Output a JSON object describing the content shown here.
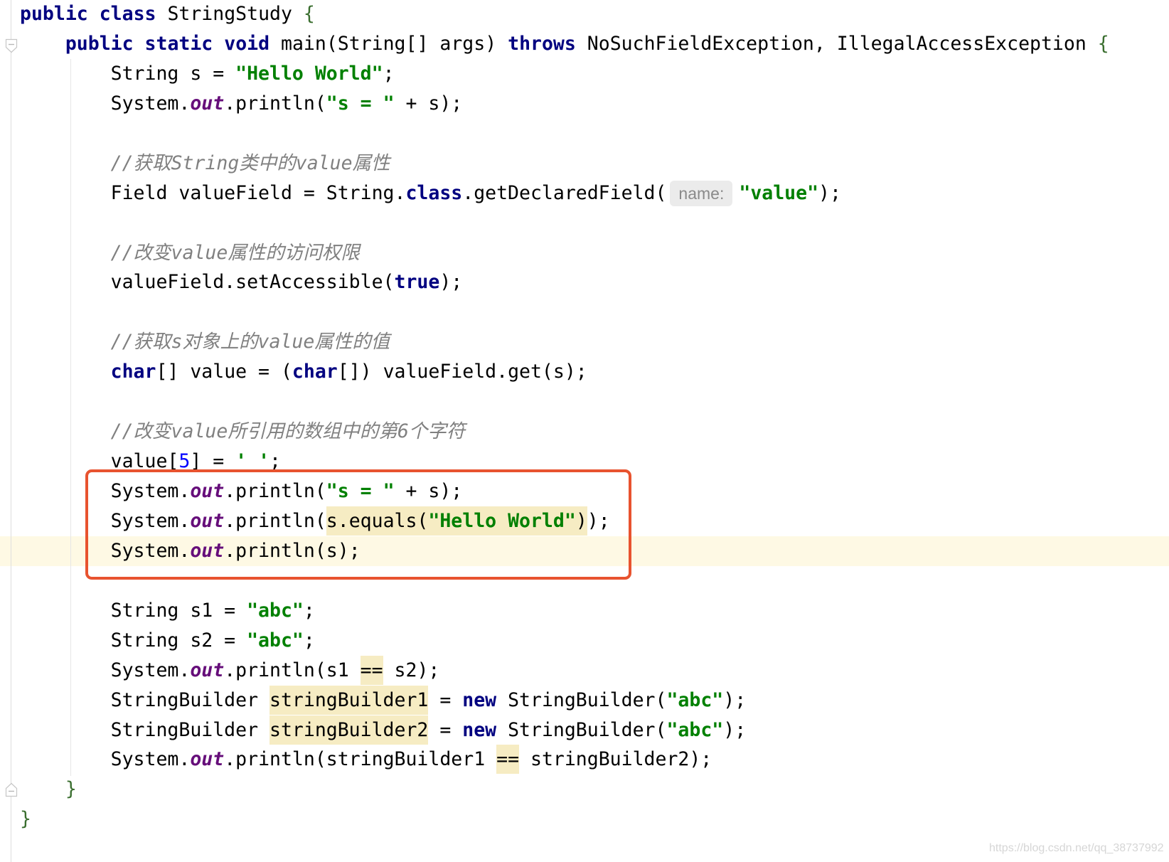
{
  "editor": {
    "theme": {
      "keyword": "#000080",
      "string": "#008000",
      "comment": "#808080",
      "static_field": "#660E7A",
      "number": "#0000FF",
      "text": "#000000",
      "brace": "#3A6E2F",
      "usage_highlight": "#F6ECC3",
      "current_line": "#FEF9E4",
      "hint_background": "#EBEBEB",
      "hint_text": "#8A8A8A"
    },
    "lines": [
      {
        "tokens": [
          {
            "k": "keyword",
            "t": "public"
          },
          {
            "k": "text",
            "t": " "
          },
          {
            "k": "keyword",
            "t": "class"
          },
          {
            "k": "text",
            "t": " StringStudy "
          },
          {
            "k": "brace",
            "t": "{"
          }
        ]
      },
      {
        "tokens": [
          {
            "k": "text",
            "t": "    "
          },
          {
            "k": "keyword",
            "t": "public"
          },
          {
            "k": "text",
            "t": " "
          },
          {
            "k": "keyword",
            "t": "static"
          },
          {
            "k": "text",
            "t": " "
          },
          {
            "k": "keyword",
            "t": "void"
          },
          {
            "k": "text",
            "t": " main(String[] args) "
          },
          {
            "k": "keyword",
            "t": "throws"
          },
          {
            "k": "text",
            "t": " NoSuchFieldException, IllegalAccessException "
          },
          {
            "k": "brace",
            "t": "{"
          }
        ]
      },
      {
        "tokens": [
          {
            "k": "text",
            "t": "        String s = "
          },
          {
            "k": "string",
            "t": "\"Hello World\""
          },
          {
            "k": "text",
            "t": ";"
          }
        ]
      },
      {
        "tokens": [
          {
            "k": "text",
            "t": "        System."
          },
          {
            "k": "field",
            "t": "out"
          },
          {
            "k": "text",
            "t": ".println("
          },
          {
            "k": "string",
            "t": "\"s = \""
          },
          {
            "k": "text",
            "t": " + s);"
          }
        ]
      },
      {
        "tokens": []
      },
      {
        "tokens": [
          {
            "k": "text",
            "t": "        "
          },
          {
            "k": "comment",
            "t": "//获取String类中的value属性"
          }
        ]
      },
      {
        "tokens": [
          {
            "k": "text",
            "t": "        Field valueField = String."
          },
          {
            "k": "keyword",
            "t": "class"
          },
          {
            "k": "text",
            "t": ".getDeclaredField("
          },
          {
            "k": "hint",
            "t": "name:"
          },
          {
            "k": "string",
            "t": "\"value\""
          },
          {
            "k": "text",
            "t": ");"
          }
        ]
      },
      {
        "tokens": []
      },
      {
        "tokens": [
          {
            "k": "text",
            "t": "        "
          },
          {
            "k": "comment",
            "t": "//改变value属性的访问权限"
          }
        ]
      },
      {
        "tokens": [
          {
            "k": "text",
            "t": "        valueField.setAccessible("
          },
          {
            "k": "keyword",
            "t": "true"
          },
          {
            "k": "text",
            "t": ");"
          }
        ]
      },
      {
        "tokens": []
      },
      {
        "tokens": [
          {
            "k": "text",
            "t": "        "
          },
          {
            "k": "comment",
            "t": "//获取s对象上的value属性的值"
          }
        ]
      },
      {
        "tokens": [
          {
            "k": "text",
            "t": "        "
          },
          {
            "k": "keyword",
            "t": "char"
          },
          {
            "k": "text",
            "t": "[] value = ("
          },
          {
            "k": "keyword",
            "t": "char"
          },
          {
            "k": "text",
            "t": "[]) valueField.get(s);"
          }
        ]
      },
      {
        "tokens": []
      },
      {
        "tokens": [
          {
            "k": "text",
            "t": "        "
          },
          {
            "k": "comment",
            "t": "//改变value所引用的数组中的第6个字符"
          }
        ]
      },
      {
        "tokens": [
          {
            "k": "text",
            "t": "        value["
          },
          {
            "k": "number",
            "t": "5"
          },
          {
            "k": "text",
            "t": "] = "
          },
          {
            "k": "string",
            "t": "' '"
          },
          {
            "k": "text",
            "t": ";"
          }
        ]
      },
      {
        "tokens": [
          {
            "k": "text",
            "t": "        System."
          },
          {
            "k": "field",
            "t": "out"
          },
          {
            "k": "text",
            "t": ".println("
          },
          {
            "k": "string",
            "t": "\"s = \""
          },
          {
            "k": "text",
            "t": " + s);"
          }
        ]
      },
      {
        "tokens": [
          {
            "k": "text",
            "t": "        System."
          },
          {
            "k": "field",
            "t": "out"
          },
          {
            "k": "text",
            "t": ".println("
          },
          {
            "k": "text",
            "t": "s.equals(",
            "hl": true
          },
          {
            "k": "string",
            "t": "\"Hello World\"",
            "hl": true
          },
          {
            "k": "text",
            "t": ")",
            "hl": true
          },
          {
            "k": "text",
            "t": ");"
          }
        ]
      },
      {
        "current": true,
        "tokens": [
          {
            "k": "text",
            "t": "        System."
          },
          {
            "k": "field",
            "t": "out"
          },
          {
            "k": "text",
            "t": ".println(s);"
          }
        ]
      },
      {
        "tokens": []
      },
      {
        "tokens": [
          {
            "k": "text",
            "t": "        String s1 = "
          },
          {
            "k": "string",
            "t": "\"abc\""
          },
          {
            "k": "text",
            "t": ";"
          }
        ]
      },
      {
        "tokens": [
          {
            "k": "text",
            "t": "        String s2 = "
          },
          {
            "k": "string",
            "t": "\"abc\""
          },
          {
            "k": "text",
            "t": ";"
          }
        ]
      },
      {
        "tokens": [
          {
            "k": "text",
            "t": "        System."
          },
          {
            "k": "field",
            "t": "out"
          },
          {
            "k": "text",
            "t": ".println(s1 "
          },
          {
            "k": "text",
            "t": "==",
            "hl": true
          },
          {
            "k": "text",
            "t": " s2);"
          }
        ]
      },
      {
        "tokens": [
          {
            "k": "text",
            "t": "        StringBuilder "
          },
          {
            "k": "text",
            "t": "stringBuilder1",
            "hl": true
          },
          {
            "k": "text",
            "t": " = "
          },
          {
            "k": "keyword",
            "t": "new"
          },
          {
            "k": "text",
            "t": " StringBuilder("
          },
          {
            "k": "string",
            "t": "\"abc\""
          },
          {
            "k": "text",
            "t": ");"
          }
        ]
      },
      {
        "tokens": [
          {
            "k": "text",
            "t": "        StringBuilder "
          },
          {
            "k": "text",
            "t": "stringBuilder2",
            "hl": true
          },
          {
            "k": "text",
            "t": " = "
          },
          {
            "k": "keyword",
            "t": "new"
          },
          {
            "k": "text",
            "t": " StringBuilder("
          },
          {
            "k": "string",
            "t": "\"abc\""
          },
          {
            "k": "text",
            "t": ");"
          }
        ]
      },
      {
        "tokens": [
          {
            "k": "text",
            "t": "        System."
          },
          {
            "k": "field",
            "t": "out"
          },
          {
            "k": "text",
            "t": ".println(stringBuilder1 "
          },
          {
            "k": "text",
            "t": "==",
            "hl": true
          },
          {
            "k": "text",
            "t": " stringBuilder2);"
          }
        ]
      },
      {
        "tokens": [
          {
            "k": "text",
            "t": "    "
          },
          {
            "k": "brace",
            "t": "}"
          }
        ]
      },
      {
        "tokens": [
          {
            "k": "brace",
            "t": "}"
          }
        ]
      }
    ]
  },
  "icons": {
    "fold_start": "fold-collapse-icon",
    "fold_end": "fold-end-icon"
  },
  "annotation": {
    "color": "#E8532F"
  },
  "watermark": "https://blog.csdn.net/qq_38737992"
}
